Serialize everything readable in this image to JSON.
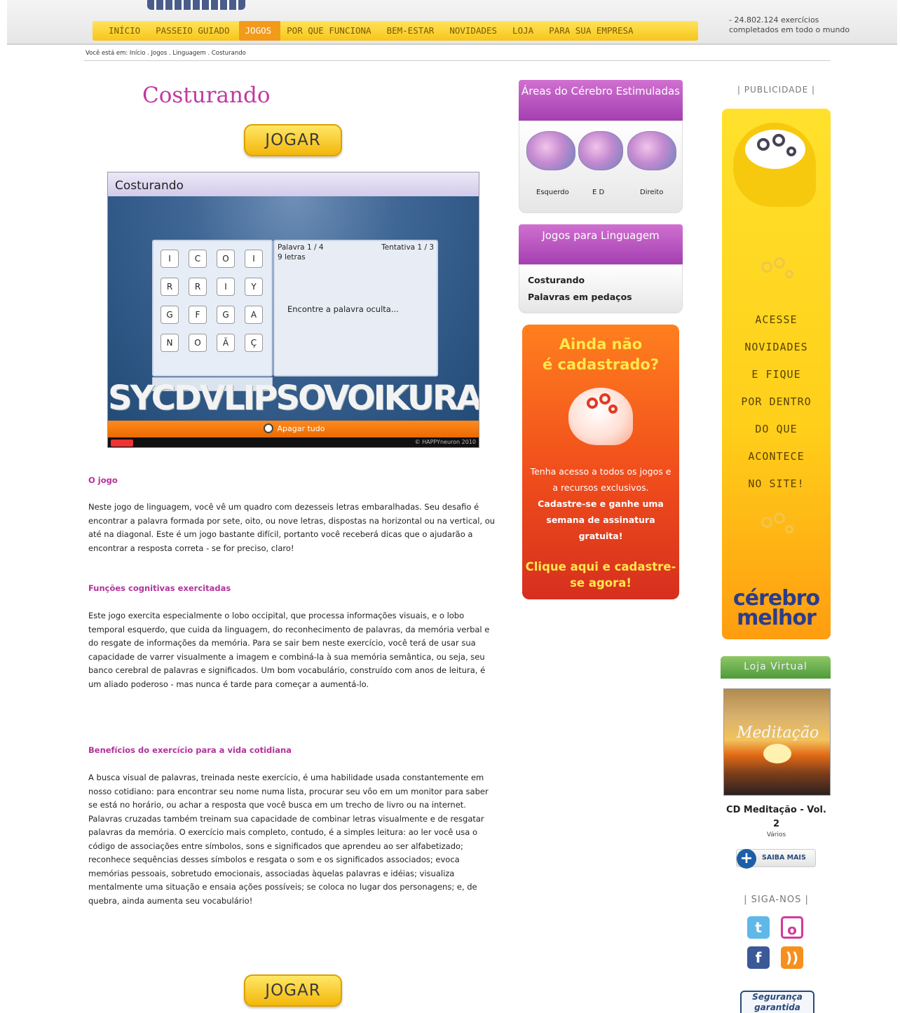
{
  "nav": {
    "items": [
      "INÍCIO",
      "PASSEIO GUIADO",
      "JOGOS",
      "POR QUE FUNCIONA",
      "BEM-ESTAR",
      "NOVIDADES",
      "LOJA",
      "PARA SUA EMPRESA"
    ],
    "active_index": 2
  },
  "counter": {
    "value": "- 24.802.124",
    "line1_suffix": "exercícios",
    "line2": "completados em todo o mundo"
  },
  "breadcrumb": "Você está em: Início . Jogos . Linguagem . Costurando",
  "game": {
    "title": "Costurando",
    "play_label": "JOGAR",
    "window_title": "Costurando",
    "grid": [
      "I",
      "C",
      "O",
      "I",
      "R",
      "R",
      "I",
      "Y",
      "G",
      "F",
      "G",
      "A",
      "N",
      "O",
      "Ã",
      "Ç"
    ],
    "word_counter": "Palavra 1 / 4",
    "attempt_counter": "Tentativa 1 / 3",
    "letters_count": "9 letras",
    "hint": "Encontre a palavra oculta...",
    "reset_label": "Apagar tudo",
    "copyright": "© HAPPYneuron 2010",
    "art_text": "SYCDVLIPSOVOIKURA"
  },
  "content": {
    "section1_title": "O jogo",
    "section1_text": "Neste jogo de linguagem, você vê um quadro com dezesseis letras embaralhadas. Seu desafio é encontrar a palavra formada por sete, oito, ou nove letras, dispostas na horizontal ou na vertical, ou até na diagonal. Este é um jogo bastante difícil, portanto você receberá dicas que o ajudarão a encontrar a resposta correta - se for preciso, claro!",
    "section2_title": "Funções cognitivas exercitadas",
    "section2_text": "Este jogo exercita especialmente o lobo occipital, que processa informações visuais, e o lobo temporal esquerdo, que cuida da linguagem, do reconhecimento de palavras, da memória verbal e do resgate de informações da memória. Para se sair bem neste exercício, você terá de usar sua capacidade de varrer visualmente a imagem e combiná-la à sua memória semântica, ou seja, seu banco cerebral de palavras e significados. Um bom vocabulário, construído com anos de leitura, é um aliado poderoso - mas nunca é tarde para começar a aumentá-lo.",
    "section3_title": "Benefícios do exercício para a vida cotidiana",
    "section3_text": "A busca visual de palavras, treinada neste exercício, é uma habilidade usada constantemente em nosso cotidiano: para encontrar seu nome numa lista, procurar seu vôo em um monitor para saber se está no horário, ou achar a resposta que você busca em um trecho de livro ou na internet. Palavras cruzadas também treinam sua capacidade de combinar letras visualmente e de resgatar palavras da memória. O exercício mais completo, contudo, é a simples leitura: ao ler você usa o código de associações entre símbolos, sons e significados que aprendeu ao ser alfabetizado; reconhece sequências desses símbolos e resgata o som e os significados associados; evoca memórias pessoais, sobretudo emocionais, associadas àquelas palavras e idéias; visualiza mentalmente uma situação e ensaia ações possíveis; se coloca no lugar dos personagens; e, de quebra, ainda aumenta seu vocabulário!"
  },
  "brain_areas": {
    "title": "Áreas do Cérebro Estimuladas",
    "labels": [
      "Esquerdo",
      "E  D",
      "Direito"
    ]
  },
  "games_box": {
    "title": "Jogos para Linguagem",
    "links": [
      "Costurando",
      "Palavras em pedaços"
    ]
  },
  "promo": {
    "title_line1": "Ainda não",
    "title_line2": "é cadastrado?",
    "text1": "Tenha acesso a todos os jogos e a recursos exclusivos.",
    "text2": "Cadastre-se e ganhe uma semana de assinatura gratuita!",
    "cta": "Clique aqui e cadastre-se agora!"
  },
  "ad": {
    "label": "| PUBLICIDADE |",
    "lines": [
      "ACESSE",
      "NOVIDADES",
      "E FIQUE",
      "POR DENTRO",
      "DO QUE",
      "ACONTECE",
      "NO SITE!"
    ],
    "brand_line1": "cérebro",
    "brand_line2": "melhor"
  },
  "shop": {
    "title": "Loja Virtual",
    "cover_text": "Meditação",
    "product_name": "CD Meditação - Vol. 2",
    "product_sub": "Vários",
    "more_label": "SAIBA MAIS"
  },
  "follow": {
    "label": "| SIGA-NOS |",
    "icons": [
      "twitter-icon",
      "orkut-icon",
      "facebook-icon",
      "rss-icon"
    ]
  },
  "seal": "Segurança garantida"
}
